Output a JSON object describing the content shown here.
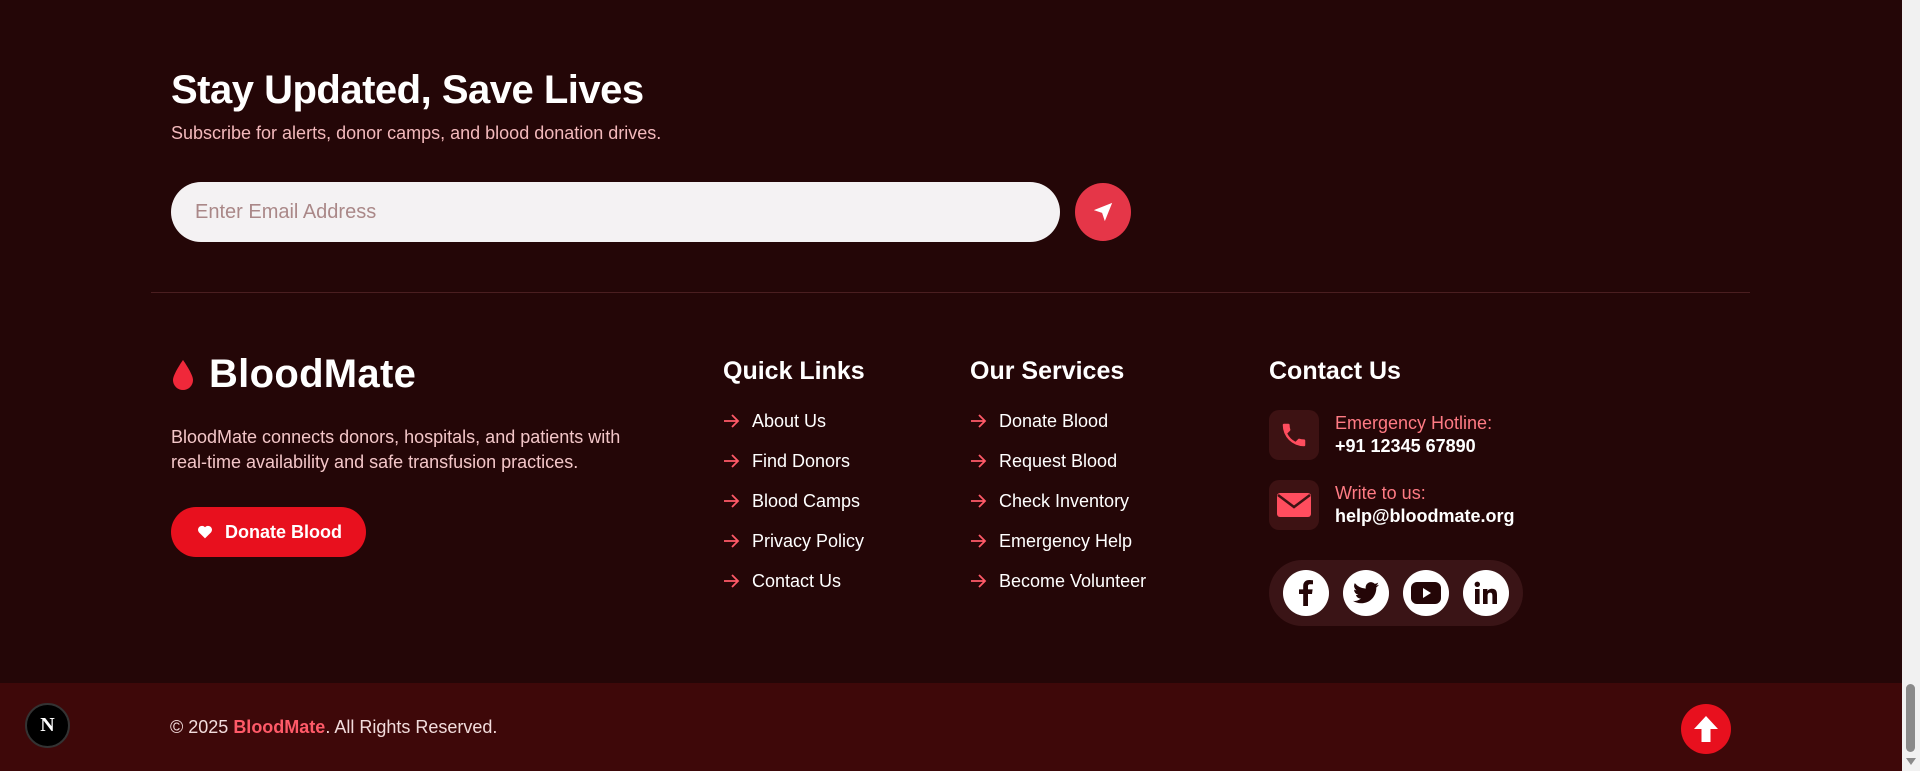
{
  "newsletter": {
    "title": "Stay Updated, Save Lives",
    "subtitle": "Subscribe for alerts, donor camps, and blood donation drives.",
    "email_placeholder": "Enter Email Address"
  },
  "brand": {
    "name": "BloodMate",
    "description": "BloodMate connects donors, hospitals, and patients with real-time availability and safe transfusion practices.",
    "donate_label": "Donate Blood"
  },
  "quick_links": {
    "title": "Quick Links",
    "items": [
      "About Us",
      "Find Donors",
      "Blood Camps",
      "Privacy Policy",
      "Contact Us"
    ]
  },
  "services": {
    "title": "Our Services",
    "items": [
      "Donate Blood",
      "Request Blood",
      "Check Inventory",
      "Emergency Help",
      "Become Volunteer"
    ]
  },
  "contact": {
    "title": "Contact Us",
    "hotline_label": "Emergency Hotline:",
    "hotline_value": "+91 12345 67890",
    "email_label": "Write to us:",
    "email_value": "help@bloodmate.org",
    "social": [
      "facebook-icon",
      "twitter-icon",
      "youtube-icon",
      "linkedin-icon"
    ]
  },
  "footer": {
    "copyright_prefix": "© 2025 ",
    "copyright_brand": "BloodMate",
    "copyright_suffix": ". All Rights Reserved.",
    "next_badge": "N"
  },
  "colors": {
    "background": "#240607",
    "accent": "#e8101e",
    "bottom_bar": "#3e0809",
    "link_arrow": "#ff5a68"
  }
}
